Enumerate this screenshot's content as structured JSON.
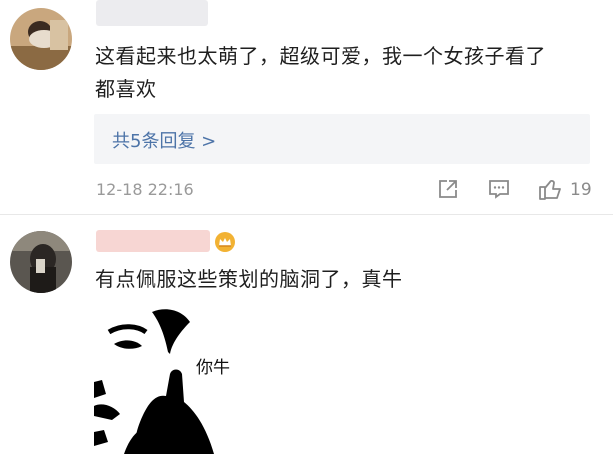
{
  "comments": [
    {
      "text_line1": "这看起来也太萌了，超级可爱，我一个女孩子看了",
      "text_line2": "都喜欢",
      "reply_link": "共5条回复 >",
      "timestamp": "12-18 22:16",
      "likes": "19",
      "icons": [
        "share-icon",
        "comment-icon",
        "like-icon"
      ]
    },
    {
      "text": "有点佩服这些策划的脑洞了，真牛",
      "badge": "crown-badge-icon",
      "meme_caption": "你牛"
    }
  ],
  "colors": {
    "link": "#4d74a8",
    "muted": "#9a9a9a",
    "reply_bg": "#f4f5f7",
    "name_blur_1": "#e8e8ec",
    "name_blur_2": "#f6d3d0"
  }
}
